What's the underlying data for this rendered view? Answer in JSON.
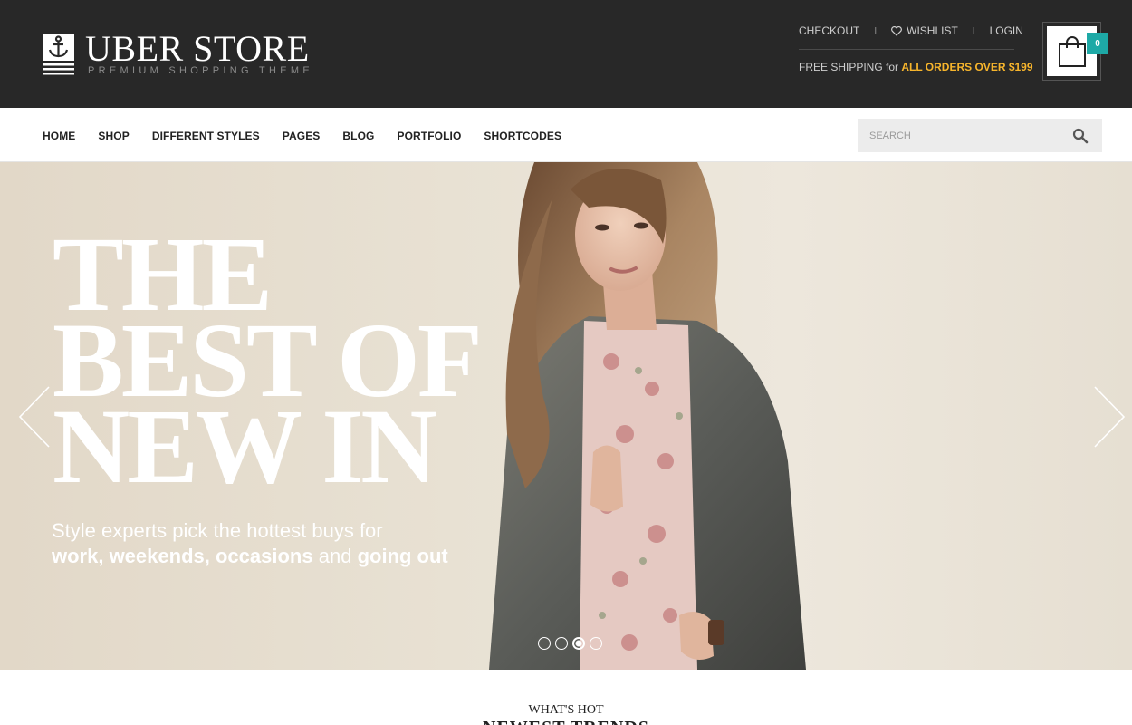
{
  "brand": {
    "title": "UBER STORE",
    "subtitle": "PREMIUM SHOPPING THEME"
  },
  "top_links": {
    "checkout": "CHECKOUT",
    "wishlist": "WISHLIST",
    "login": "LOGIN",
    "separator": "I"
  },
  "shipping": {
    "prefix": "FREE SHIPPING for ",
    "highlight": "ALL ORDERS OVER $199"
  },
  "cart": {
    "count": "0"
  },
  "nav": {
    "items": [
      "HOME",
      "SHOP",
      "DIFFERENT STYLES",
      "PAGES",
      "BLOG",
      "PORTFOLIO",
      "SHORTCODES"
    ]
  },
  "search": {
    "placeholder": "SEARCH"
  },
  "hero": {
    "line1": "THE",
    "line2": "BEST OF",
    "line3": "NEW IN",
    "sub_text": "Style experts pick the hottest buys for",
    "sub_w1": "work, weekends,",
    "sub_w2": "occasions",
    "sub_and": "and",
    "sub_w3": "going out",
    "slides": 4,
    "active_slide": 3
  },
  "section": {
    "eyebrow": "WHAT'S HOT",
    "title": "NEWEST TRENDS"
  },
  "colors": {
    "header_bg": "#282828",
    "accent_teal": "#1ea9a6",
    "accent_yellow": "#f7b52c"
  }
}
